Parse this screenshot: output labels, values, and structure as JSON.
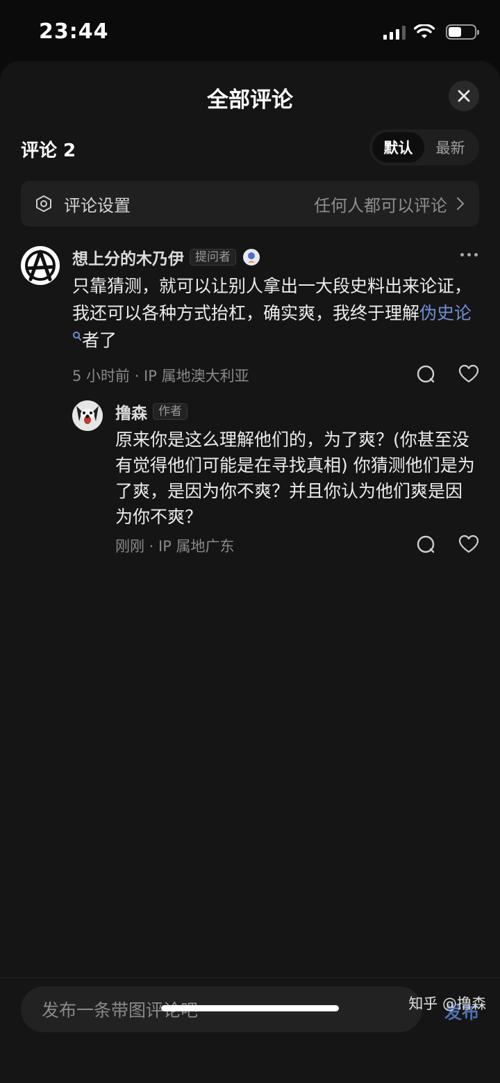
{
  "status": {
    "time": "23:44"
  },
  "sheet": {
    "title": "全部评论"
  },
  "comments_header": {
    "count_label": "评论 2",
    "sort_default": "默认",
    "sort_latest": "最新"
  },
  "settings": {
    "label": "评论设置",
    "value": "任何人都可以评论"
  },
  "comments": [
    {
      "author": "想上分的木乃伊",
      "badge": "提问者",
      "text_before": "只靠猜测，就可以让别人拿出一大段史料出来论证，我还可以各种方式抬杠，确实爽，我终于理解",
      "link": "伪史论",
      "text_after": "者了",
      "meta": "5 小时前 · IP 属地澳大利亚"
    },
    {
      "author": "撸森",
      "badge": "作者",
      "text": "原来你是这么理解他们的，为了爽？(你甚至没有觉得他们可能是在寻找真相) 你猜测他们是为了爽，是因为你不爽？并且你认为他们爽是因为你不爽？",
      "meta": "刚刚 · IP 属地广东"
    }
  ],
  "composer": {
    "placeholder": "发布一条带图评论吧",
    "publish": "发布"
  },
  "watermark": "知乎 @撸森",
  "colors": {
    "link": "#6f8fd6",
    "publish": "#4a6fae",
    "background": "#151515"
  }
}
